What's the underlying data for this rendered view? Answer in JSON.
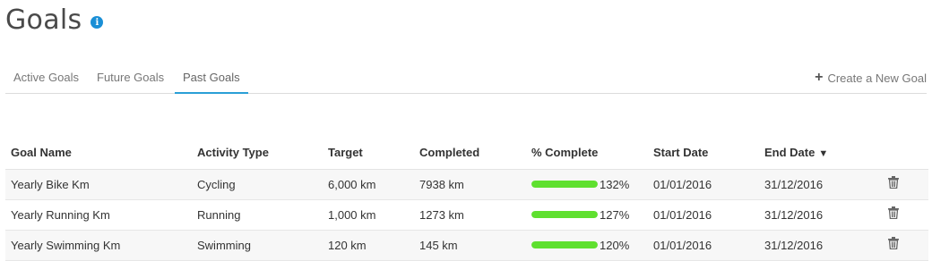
{
  "header": {
    "title": "Goals",
    "info_icon": "info-icon",
    "info_glyph": "i"
  },
  "tabs": [
    {
      "label": "Active Goals",
      "active": false
    },
    {
      "label": "Future Goals",
      "active": false
    },
    {
      "label": "Past Goals",
      "active": true
    }
  ],
  "actions": {
    "create_label": "Create a New Goal",
    "create_icon": "plus-icon",
    "plus_glyph": "+"
  },
  "table": {
    "columns": [
      "Goal Name",
      "Activity Type",
      "Target",
      "Completed",
      "% Complete",
      "Start Date",
      "End Date"
    ],
    "sort_glyph": "▼",
    "rows": [
      {
        "name": "Yearly Bike Km",
        "activity": "Cycling",
        "target": "6,000 km",
        "completed": "7938 km",
        "percent_label": "132%",
        "percent": 132,
        "start": "01/01/2016",
        "end": "31/12/2016"
      },
      {
        "name": "Yearly Running Km",
        "activity": "Running",
        "target": "1,000 km",
        "completed": "1273 km",
        "percent_label": "127%",
        "percent": 127,
        "start": "01/01/2016",
        "end": "31/12/2016"
      },
      {
        "name": "Yearly Swimming Km",
        "activity": "Swimming",
        "target": "120 km",
        "completed": "145 km",
        "percent_label": "120%",
        "percent": 120,
        "start": "01/01/2016",
        "end": "31/12/2016"
      }
    ]
  },
  "colors": {
    "accent": "#2a9fd6",
    "progress": "#5fe02f",
    "info": "#1a8fd6"
  }
}
